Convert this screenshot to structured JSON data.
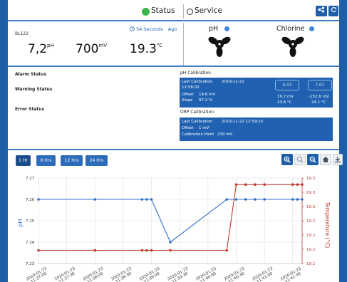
{
  "header": {
    "status_label": "Status",
    "service_label": "Service",
    "status_color": "#3bb54a",
    "settings_icon": "share-settings-icon",
    "refresh_icon": "refresh-icon"
  },
  "readings": {
    "device": "BL122",
    "timer_value": "54 Seconds",
    "timer_suffix": "Ago",
    "ph_value": "7,2",
    "ph_unit": "pH",
    "mv_value": "700",
    "mv_unit": "mV",
    "temp_value": "19.3",
    "temp_unit": "°C"
  },
  "sensors": [
    {
      "label": "pH",
      "dot_color": "#3d86d8"
    },
    {
      "label": "Chlorine",
      "dot_color": "#3d86d8"
    }
  ],
  "status": {
    "alarm": "Alarm Status",
    "warning": "Warning Status",
    "error": "Error Status"
  },
  "ph_calibration": {
    "title": "pH Calibration",
    "last_label": "Last Calibration",
    "last_date": "2019-11-22",
    "last_time": "12:58:02",
    "offset_label": "Offset",
    "offset_value": "19.6 mV",
    "slope_label": "Slope",
    "slope_value": "97.2 %",
    "buffer1": {
      "label": "4.01",
      "mv": "19.7 mV",
      "temp": "23.6 °C"
    },
    "buffer2": {
      "label": "7.01",
      "mv": "-152.6 mV",
      "temp": "24.1 °C"
    }
  },
  "orp_calibration": {
    "title": "ORP Calibration",
    "last_label": "Last Calibration",
    "last_value": "2019-11-22 12:59:15",
    "offset_label": "Offset",
    "offset_value": "1 mV",
    "point_label": "Calibration Point",
    "point_value": "239 mV"
  },
  "ranges": [
    "1 Hr",
    "6 Hrs",
    "12 Hrs",
    "24 Hrs"
  ],
  "chart_tools": [
    "zoom-in-icon",
    "zoom-selection-icon",
    "zoom-out-icon",
    "home-icon",
    "download-icon"
  ],
  "chart_data": {
    "type": "line",
    "xlabel": "",
    "ylabel": "pH",
    "ylabel_right": "Temperature (°C)",
    "x_ticks": [
      "2020-01-23 11:37:00",
      "2020-01-23 11:37:30",
      "2020-01-23 11:38:00",
      "2020-01-23 11:38:30",
      "2020-01-23 11:39:00",
      "2020-01-23 11:39:30",
      "2020-01-23 11:40:00",
      "2020-01-23 11:40:30",
      "2020-01-23 11:41:00",
      "2020-01-23 11:41:30"
    ],
    "ylim": [
      7.23,
      7.27
    ],
    "y_ticks": [
      "7.27",
      "7.26",
      "7.25",
      "7.24",
      "7.23"
    ],
    "y2_ticks": [
      "19.3",
      "19.3",
      "19.3",
      "19.2",
      "19.2",
      "19.2",
      "19.2"
    ],
    "series": [
      {
        "name": "pH",
        "axis": "left",
        "color": "#2f6fc4",
        "x": [
          "11:37:00",
          "11:38:00",
          "11:38:50",
          "11:38:55",
          "11:39:00",
          "11:39:20",
          "11:40:20",
          "11:40:30",
          "11:40:40",
          "11:40:50",
          "11:41:00",
          "11:41:30",
          "11:41:35",
          "11:41:40"
        ],
        "values": [
          7.26,
          7.26,
          7.26,
          7.26,
          7.26,
          7.24,
          7.26,
          7.26,
          7.26,
          7.26,
          7.26,
          7.26,
          7.26,
          7.26
        ]
      },
      {
        "name": "Temperature",
        "axis": "right",
        "color": "#c0392b",
        "x": [
          "11:37:00",
          "11:38:00",
          "11:38:50",
          "11:38:55",
          "11:39:00",
          "11:39:20",
          "11:40:20",
          "11:40:30",
          "11:40:40",
          "11:40:50",
          "11:41:00",
          "11:41:30",
          "11:41:35",
          "11:41:40"
        ],
        "values": [
          19.2,
          19.2,
          19.2,
          19.2,
          19.2,
          19.2,
          19.2,
          19.3,
          19.3,
          19.3,
          19.3,
          19.3,
          19.3,
          19.3
        ]
      }
    ]
  }
}
